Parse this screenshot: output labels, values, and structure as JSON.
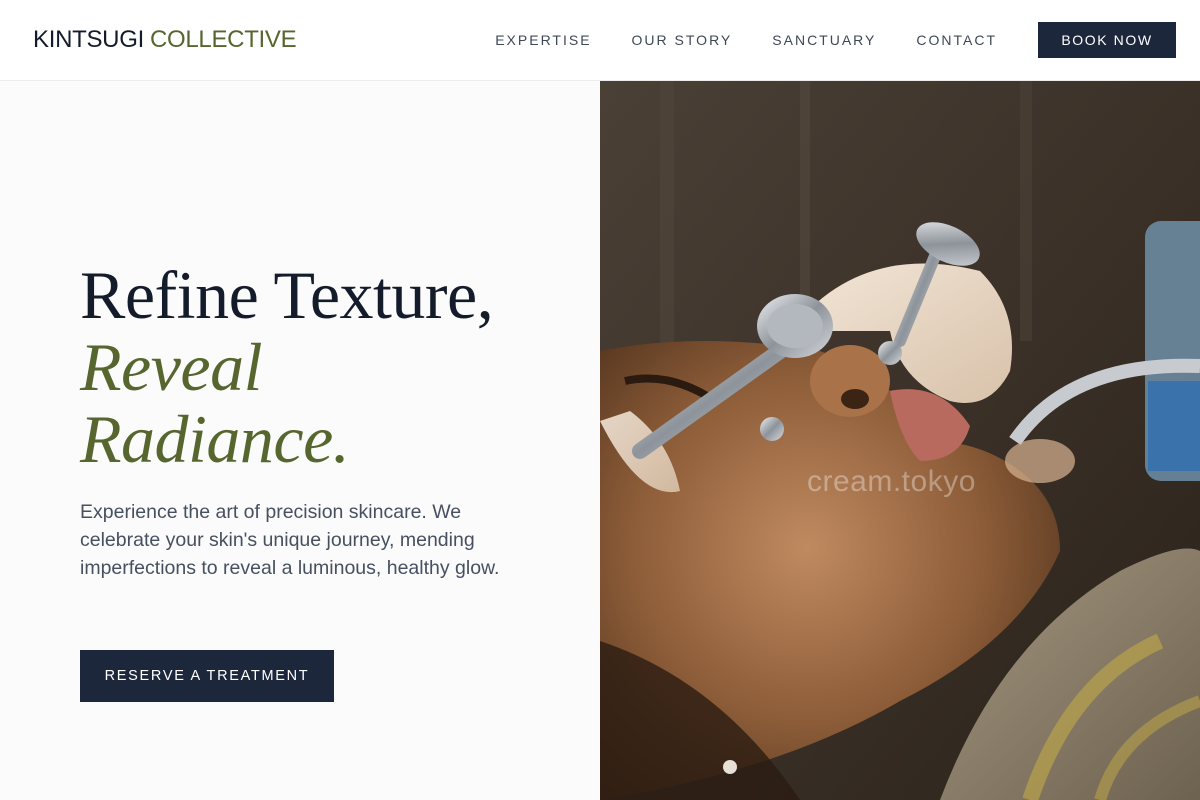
{
  "brand": {
    "part1": "KINTSUGI",
    "part2": "COLLECTIVE"
  },
  "nav": {
    "items": [
      {
        "label": "EXPERTISE"
      },
      {
        "label": "OUR STORY"
      },
      {
        "label": "SANCTUARY"
      },
      {
        "label": "CONTACT"
      }
    ],
    "cta": "BOOK NOW"
  },
  "hero": {
    "headline_line1": "Refine Texture,",
    "headline_accent_1": "Reveal",
    "headline_accent_2": "Radiance.",
    "body": "Experience the art of precision skincare. We celebrate your skin's unique journey, mending imperfections to reveal a luminous, healthy glow.",
    "cta": "RESERVE A TREATMENT",
    "image_watermark": "cream.tokyo"
  },
  "colors": {
    "navy": "#1c273b",
    "olive": "#56662e",
    "text_muted": "#475061",
    "page_bg": "#fbfbfb"
  }
}
